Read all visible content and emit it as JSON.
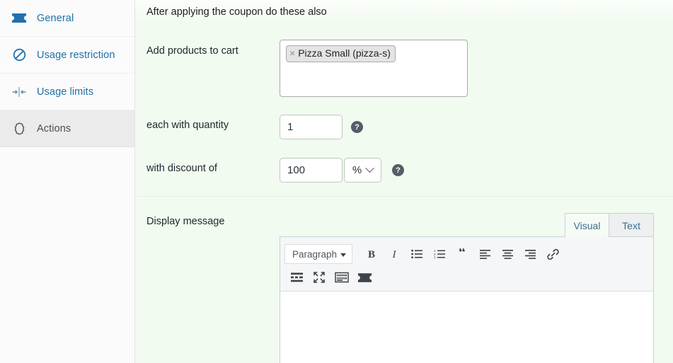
{
  "sidebar": {
    "items": [
      {
        "label": "General",
        "icon": "ticket-icon",
        "active": false
      },
      {
        "label": "Usage restriction",
        "icon": "prohibited-icon",
        "active": false
      },
      {
        "label": "Usage limits",
        "icon": "usage-limits-icon",
        "active": false
      },
      {
        "label": "Actions",
        "icon": "gear-icon",
        "active": true
      }
    ]
  },
  "main": {
    "section_title": "After applying the coupon do these also",
    "fields": {
      "products_label": "Add products to cart",
      "products_tokens": [
        {
          "remove_glyph": "×",
          "label": "Pizza Small (pizza-s)"
        }
      ],
      "quantity_label": "each with quantity",
      "quantity_value": "1",
      "discount_label": "with discount of",
      "discount_value": "100",
      "discount_unit": "%",
      "help_glyph": "?"
    },
    "editor": {
      "label": "Display message",
      "tabs": [
        {
          "label": "Visual",
          "active": true
        },
        {
          "label": "Text",
          "active": false
        }
      ],
      "format_select": "Paragraph",
      "toolbar_row1": [
        {
          "name": "bold-icon",
          "title": "Bold"
        },
        {
          "name": "italic-icon",
          "title": "Italic"
        },
        {
          "name": "bulleted-list-icon",
          "title": "Bulleted list"
        },
        {
          "name": "numbered-list-icon",
          "title": "Numbered list"
        },
        {
          "name": "blockquote-icon",
          "title": "Blockquote"
        },
        {
          "name": "align-left-icon",
          "title": "Align left"
        },
        {
          "name": "align-center-icon",
          "title": "Align center"
        },
        {
          "name": "align-right-icon",
          "title": "Align right"
        },
        {
          "name": "link-icon",
          "title": "Insert/edit link"
        }
      ],
      "toolbar_row2": [
        {
          "name": "read-more-icon",
          "title": "Insert Read More tag"
        },
        {
          "name": "fullscreen-icon",
          "title": "Distraction-free writing mode"
        },
        {
          "name": "toolbar-toggle-icon",
          "title": "Toolbar Toggle"
        },
        {
          "name": "coupon-ticket-icon",
          "title": "Insert coupon shortcode"
        }
      ],
      "content": ""
    }
  },
  "colors": {
    "panel_bg": "#f1fbf0",
    "sidebar_bg": "#fbfbfb",
    "sidebar_active_bg": "#ebebeb",
    "link_blue": "#1f6fa5",
    "icon_blue": "#2271b1",
    "help_gray": "#555d66",
    "editor_border": "#ccd0d4"
  }
}
